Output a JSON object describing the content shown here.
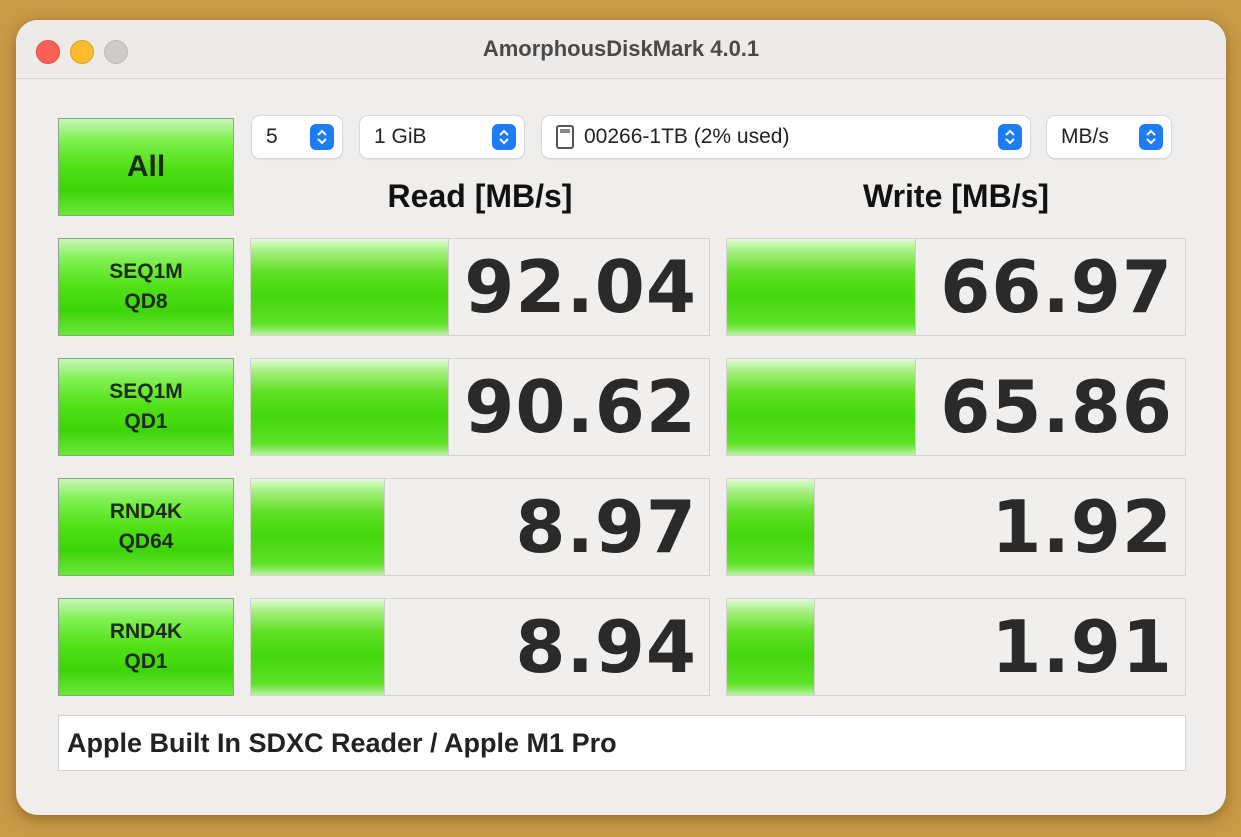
{
  "window": {
    "title": "AmorphousDiskMark 4.0.1"
  },
  "controls": {
    "all_label": "All",
    "count": "5",
    "size": "1 GiB",
    "target": "00266-1TB (2% used)",
    "unit": "MB/s"
  },
  "headers": {
    "read": "Read [MB/s]",
    "write": "Write [MB/s]"
  },
  "tests": [
    {
      "line1": "SEQ1M",
      "line2": "QD8",
      "read": "92.04",
      "write": "66.97",
      "read_fill": 0.43,
      "write_fill": 0.41
    },
    {
      "line1": "SEQ1M",
      "line2": "QD1",
      "read": "90.62",
      "write": "65.86",
      "read_fill": 0.43,
      "write_fill": 0.41
    },
    {
      "line1": "RND4K",
      "line2": "QD64",
      "read": "8.97",
      "write": "1.92",
      "read_fill": 0.29,
      "write_fill": 0.19
    },
    {
      "line1": "RND4K",
      "line2": "QD1",
      "read": "8.94",
      "write": "1.91",
      "read_fill": 0.29,
      "write_fill": 0.19
    }
  ],
  "comment": "Apple Built In SDXC Reader / Apple M1 Pro",
  "colors": {
    "accent": "#1e7cf6",
    "bar_green": "#45d70e",
    "close": "#fe5f57",
    "minimize": "#febc2e",
    "zoom": "#cfcdcb"
  },
  "icons": {
    "stepper": "chevron-up-down-icon",
    "disk": "sd-card-icon"
  }
}
